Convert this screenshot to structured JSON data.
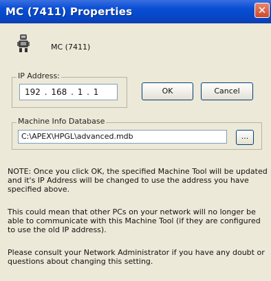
{
  "window": {
    "title": "MC (7411) Properties",
    "close_symbol": "✕"
  },
  "header": {
    "machine_name": "MC (7411)",
    "icon": "machine-tool-icon"
  },
  "ip_group": {
    "label": "IP Address:",
    "value": "192 . 168 .  1  .  1"
  },
  "buttons": {
    "ok_label": "OK",
    "cancel_label": "Cancel"
  },
  "db_group": {
    "label": "Machine Info Database",
    "path": "C:\\APEX\\HPGL\\advanced.mdb",
    "browse_label": "..."
  },
  "notes": [
    "NOTE: Once you click OK, the specified Machine Tool will be updated and it's IP Address will be changed to use the address you have specified above.",
    "This could mean that other PCs on your network will no longer be able to communicate with this Machine Tool (if they are configured to use the old IP address).",
    "Please consult your Network Administrator if you have any doubt or questions about changing this setting."
  ],
  "colors": {
    "titlebar": "#0a4fd6",
    "window_bg": "#ece9d8",
    "close_button": "#d0482b"
  }
}
